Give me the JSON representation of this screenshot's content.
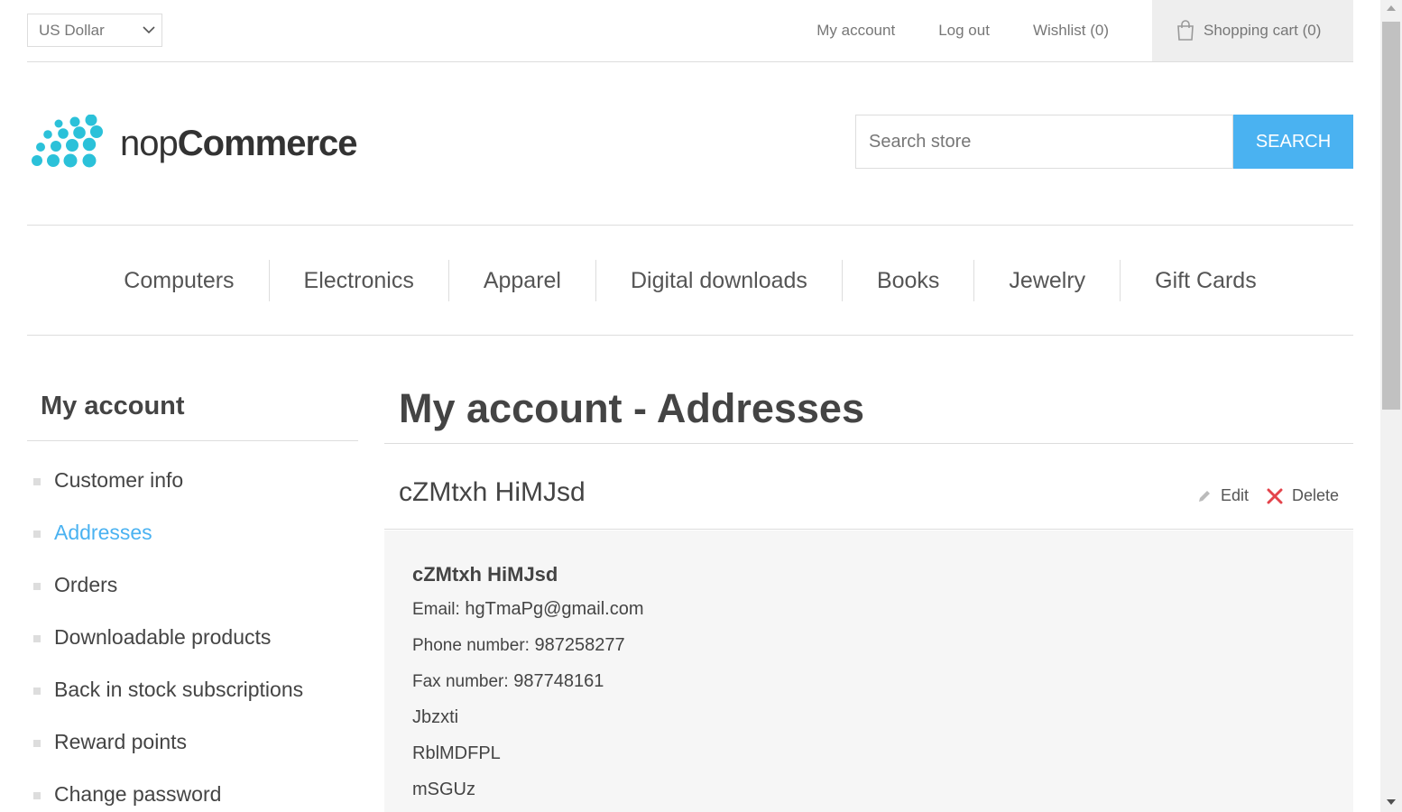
{
  "header": {
    "currency": "US Dollar",
    "links": {
      "my_account": "My account",
      "log_out": "Log out",
      "wishlist": "Wishlist (0)",
      "shopping_cart": "Shopping cart (0)"
    }
  },
  "logo": {
    "text_light": "nop",
    "text_bold": "Commerce",
    "dot_color": "#2bc1d9"
  },
  "search": {
    "placeholder": "Search store",
    "button": "SEARCH",
    "button_color": "#4ab2f1"
  },
  "menu": [
    "Computers",
    "Electronics",
    "Apparel",
    "Digital downloads",
    "Books",
    "Jewelry",
    "Gift Cards"
  ],
  "sidebar": {
    "title": "My account",
    "items": [
      "Customer info",
      "Addresses",
      "Orders",
      "Downloadable products",
      "Back in stock subscriptions",
      "Reward points",
      "Change password"
    ],
    "active_item": "Addresses",
    "active_color": "#4ab2f1"
  },
  "main": {
    "title": "My account - Addresses",
    "address": {
      "header_name": "cZMtxh HiMJsd",
      "edit_label": "Edit",
      "delete_label": "Delete",
      "name": "cZMtxh HiMJsd",
      "email_label": "Email:",
      "email": "hgTmaPg@gmail.com",
      "phone_label": "Phone number:",
      "phone": "987258277",
      "fax_label": "Fax number:",
      "fax": "987748161",
      "line1": "Jbzxti",
      "line2": "RblMDFPL",
      "line3": "mSGUz"
    }
  }
}
